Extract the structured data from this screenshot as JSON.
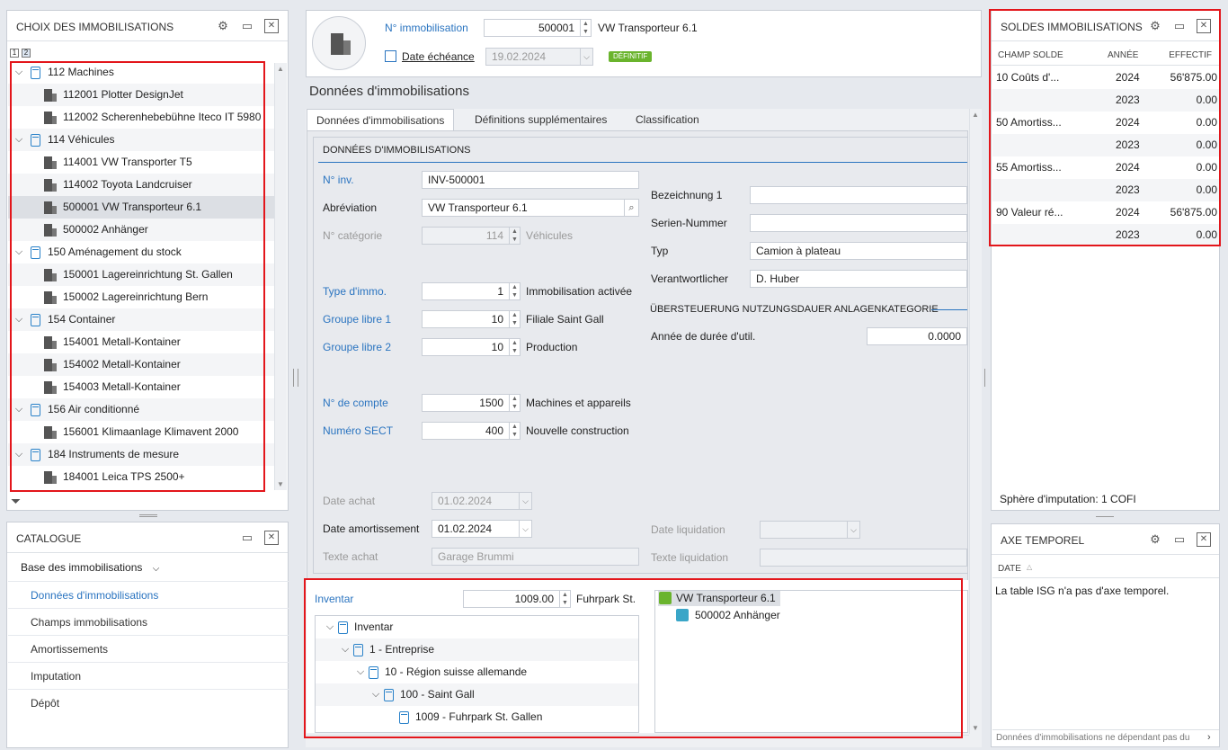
{
  "left_panel": {
    "title": "CHOIX DES IMMOBILISATIONS",
    "level_buttons": [
      "1",
      "2"
    ],
    "tree": [
      {
        "type": "group",
        "label": "112 Machines"
      },
      {
        "type": "item",
        "label": "112001 Plotter DesignJet"
      },
      {
        "type": "item",
        "label": "112002 Scherenhebebühne Iteco IT 5980"
      },
      {
        "type": "group",
        "label": "114 Véhicules"
      },
      {
        "type": "item",
        "label": "114001 VW Transporter T5"
      },
      {
        "type": "item",
        "label": "114002 Toyota Landcruiser"
      },
      {
        "type": "item",
        "label": "500001 VW Transporteur 6.1",
        "selected": true
      },
      {
        "type": "item",
        "label": "500002 Anhänger"
      },
      {
        "type": "group",
        "label": "150 Aménagement du stock"
      },
      {
        "type": "item",
        "label": "150001 Lagereinrichtung St. Gallen"
      },
      {
        "type": "item",
        "label": "150002 Lagereinrichtung Bern"
      },
      {
        "type": "group",
        "label": "154 Container"
      },
      {
        "type": "item",
        "label": "154001 Metall-Kontainer"
      },
      {
        "type": "item",
        "label": "154002 Metall-Kontainer"
      },
      {
        "type": "item",
        "label": "154003 Metall-Kontainer"
      },
      {
        "type": "group",
        "label": "156 Air conditionné"
      },
      {
        "type": "item",
        "label": "156001 Klimaanlage Klimavent 2000"
      },
      {
        "type": "group",
        "label": "184 Instruments de mesure"
      },
      {
        "type": "item",
        "label": "184001 Leica TPS 2500+"
      }
    ]
  },
  "catalogue": {
    "title": "CATALOGUE",
    "section": "Base des immobilisations",
    "items": [
      "Données d'immobilisations",
      "Champs immobilisations",
      "Amortissements",
      "Imputation",
      "Dépôt"
    ],
    "active_index": 0
  },
  "header": {
    "asset_no_label": "N° immobilisation",
    "asset_no_value": "500001",
    "asset_name": "VW Transporteur 6.1",
    "due_date_label": "Date échéance",
    "due_date_value": "19.02.2024",
    "status_badge": "DÉFINITIF",
    "status_color": "#6ab42d"
  },
  "main": {
    "section_title": "Données d'immobilisations",
    "tabs": [
      "Données d'immobilisations",
      "Définitions supplémentaires",
      "Classification"
    ],
    "group_title": "DONNÉES D'IMMOBILISATIONS",
    "fields": {
      "inv_no_label": "N° inv.",
      "inv_no_value": "INV-500001",
      "abbr_label": "Abréviation",
      "abbr_value": "VW Transporteur 6.1",
      "category_label": "N° catégorie",
      "category_value": "114",
      "category_text": "Véhicules",
      "type_label": "Type d'immo.",
      "type_value": "1",
      "type_text": "Immobilisation activée",
      "group1_label": "Groupe libre 1",
      "group1_value": "10",
      "group1_text": "Filiale Saint Gall",
      "group2_label": "Groupe libre 2",
      "group2_value": "10",
      "group2_text": "Production",
      "account_label": "N° de compte",
      "account_value": "1500",
      "account_text": "Machines et appareils",
      "sect_label": "Numéro SECT",
      "sect_value": "400",
      "sect_text": "Nouvelle construction",
      "purchase_date_label": "Date achat",
      "purchase_date_value": "01.02.2024",
      "depr_date_label": "Date amortissement",
      "depr_date_value": "01.02.2024",
      "purchase_text_label": "Texte achat",
      "purchase_text_value": "Garage Brummi",
      "bez_label": "Bezeichnung 1",
      "bez_value": "",
      "serial_label": "Serien-Nummer",
      "serial_value": "",
      "typ_label": "Typ",
      "typ_value": "Camion à plateau",
      "resp_label": "Verantwortlicher",
      "resp_value": "D. Huber",
      "override_title": "ÜBERSTEUERUNG NUTZUNGSDAUER ANLAGENKATEGORIE",
      "life_label": "Année de durée d'util.",
      "life_value": "0.0000",
      "liq_date_label": "Date liquidation",
      "liq_date_value": "",
      "liq_text_label": "Texte liquidation",
      "liq_text_value": ""
    },
    "inventory": {
      "label": "Inventar",
      "value": "1009.00",
      "text": "Fuhrpark St.",
      "tree": [
        {
          "level": 0,
          "label": "Inventar"
        },
        {
          "level": 1,
          "label": "1 - Entreprise"
        },
        {
          "level": 2,
          "label": "10 - Région suisse allemande"
        },
        {
          "level": 3,
          "label": "100 - Saint Gall"
        },
        {
          "level": 4,
          "label": "1009 - Fuhrpark St. Gallen"
        }
      ],
      "right_tree": [
        {
          "level": 0,
          "label": "VW Transporteur 6.1"
        },
        {
          "level": 1,
          "label": "500002 Anhänger"
        }
      ]
    }
  },
  "balances": {
    "title": "SOLDES IMMOBILISATIONS",
    "columns": [
      "CHAMP SOLDE",
      "ANNÉE",
      "EFFECTIF"
    ],
    "rows": [
      {
        "field": "10 Coûts d'...",
        "year": "2024",
        "value": "56'875.00"
      },
      {
        "field": "",
        "year": "2023",
        "value": "0.00"
      },
      {
        "field": "50 Amortiss...",
        "year": "2024",
        "value": "0.00"
      },
      {
        "field": "",
        "year": "2023",
        "value": "0.00"
      },
      {
        "field": "55 Amortiss...",
        "year": "2024",
        "value": "0.00"
      },
      {
        "field": "",
        "year": "2023",
        "value": "0.00"
      },
      {
        "field": "90 Valeur ré...",
        "year": "2024",
        "value": "56'875.00"
      },
      {
        "field": "",
        "year": "2023",
        "value": "0.00"
      }
    ],
    "footer": "Sphère d'imputation: 1 COFI"
  },
  "timeline": {
    "title": "AXE TEMPOREL",
    "column": "DATE",
    "message": "La table ISG n'a pas d'axe temporel.",
    "footer": "Données d'immobilisations ne dépendant pas du"
  }
}
